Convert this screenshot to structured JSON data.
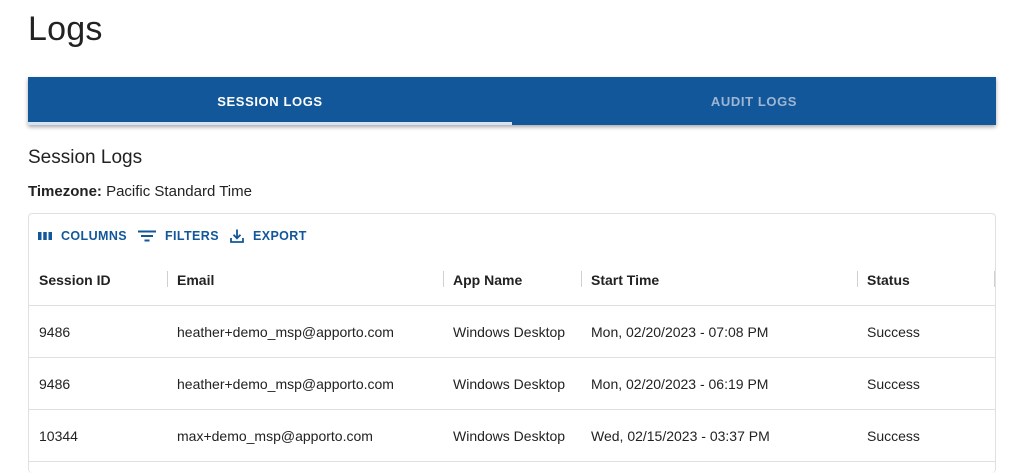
{
  "page": {
    "title": "Logs"
  },
  "tabs": [
    {
      "label": "SESSION LOGS",
      "active": true
    },
    {
      "label": "AUDIT LOGS",
      "active": false
    }
  ],
  "section": {
    "title": "Session Logs",
    "timezone_label": "Timezone:",
    "timezone_value": "Pacific Standard Time"
  },
  "toolbar": {
    "columns_label": "COLUMNS",
    "filters_label": "FILTERS",
    "export_label": "EXPORT",
    "columns_icon": "view-column-icon",
    "filters_icon": "filter-list-icon",
    "export_icon": "download-icon"
  },
  "table": {
    "columns": [
      "Session ID",
      "Email",
      "App Name",
      "Start Time",
      "Status"
    ],
    "rows": [
      [
        "9486",
        "heather+demo_msp@apporto.com",
        "Windows Desktop",
        "Mon, 02/20/2023 - 07:08 PM",
        "Success"
      ],
      [
        "9486",
        "heather+demo_msp@apporto.com",
        "Windows Desktop",
        "Mon, 02/20/2023 - 06:19 PM",
        "Success"
      ],
      [
        "10344",
        "max+demo_msp@apporto.com",
        "Windows Desktop",
        "Wed, 02/15/2023 - 03:37 PM",
        "Success"
      ]
    ]
  },
  "colors": {
    "primary": "#12579a",
    "tab_inactive_text": "#9eb6d3",
    "tab_indicator": "#d7e3f2",
    "border": "#e0e0e0"
  }
}
